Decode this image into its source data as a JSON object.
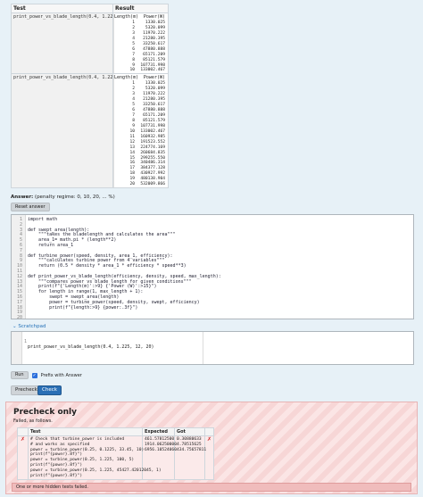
{
  "example_table": {
    "col_test": "Test",
    "col_result": "Result",
    "result_header_length": "Length(m)",
    "result_header_power": "Power(W)",
    "row1": {
      "test": "print_power_vs_blade_length(0.4, 1.225, 12, 10)",
      "rows": [
        [
          "1",
          "1330.025"
        ],
        [
          "2",
          "5320.099"
        ],
        [
          "3",
          "11970.222"
        ],
        [
          "4",
          "21280.395"
        ],
        [
          "5",
          "33250.617"
        ],
        [
          "6",
          "47880.888"
        ],
        [
          "7",
          "65171.209"
        ],
        [
          "8",
          "85121.579"
        ],
        [
          "9",
          "107731.998"
        ],
        [
          "10",
          "133002.467"
        ]
      ]
    },
    "row2": {
      "test": "print_power_vs_blade_length(0.4, 1.225, 12, 20)",
      "rows": [
        [
          "1",
          "1330.025"
        ],
        [
          "2",
          "5320.099"
        ],
        [
          "3",
          "11970.222"
        ],
        [
          "4",
          "21280.395"
        ],
        [
          "5",
          "33250.617"
        ],
        [
          "6",
          "47880.888"
        ],
        [
          "7",
          "65171.209"
        ],
        [
          "8",
          "85121.579"
        ],
        [
          "9",
          "107731.998"
        ],
        [
          "10",
          "133002.467"
        ],
        [
          "11",
          "160932.985"
        ],
        [
          "12",
          "191523.552"
        ],
        [
          "13",
          "224774.169"
        ],
        [
          "14",
          "260684.835"
        ],
        [
          "15",
          "299255.550"
        ],
        [
          "16",
          "340486.314"
        ],
        [
          "17",
          "384377.128"
        ],
        [
          "18",
          "430927.992"
        ],
        [
          "19",
          "480138.904"
        ],
        [
          "20",
          "532009.866"
        ]
      ]
    }
  },
  "answer": {
    "label": "Answer:",
    "penalty": "(penalty regime: 0, 10, 20, ... %)",
    "reset_label": "Reset answer"
  },
  "code_lines": [
    "import math",
    "",
    "def swept_area(length):",
    "    \"\"\"takes the bladelength and calculates the area\"\"\"",
    "    area_1= math.pi * (length**2)",
    "    return area_1",
    "",
    "def turbine_power(speed, density, area_1, efficiency):",
    "    \"\"\"calculates turbine power from 4 variables\"\"\"",
    "    return (0.5 * density * area_1 * efficiency * speed**3)",
    "",
    "def print_power_vs_blade_length(efficiency, density, speed, max_length):",
    "    \"\"\"compares power vs blade length for given conditions\"\"\"",
    "    print(f\"{'Length(m)':>9} {'Power (W)':>15}\")",
    "    for length in range(1, max_length + 1):",
    "        swept = swept_area(length)",
    "        power = turbine_power(speed, density, swept, efficiency)",
    "        print(f\"{length:>9} {power:.3f}\")",
    "",
    ""
  ],
  "scratchpad": {
    "toggle_label": "Scratchpad",
    "line_number": "1",
    "code": "print_power_vs_blade_length(0.4, 1.225, 12, 20)",
    "run_label": "Run",
    "prefix_label": "Prefix with Answer",
    "prefix_checked": true
  },
  "buttons": {
    "precheck": "Precheck",
    "check": "Check"
  },
  "results": {
    "title": "Precheck only",
    "subtitle": "Failed, as follows.",
    "col_test": "Test",
    "col_expected": "Expected",
    "col_got": "Got",
    "test_code": "# Check that turbine_power is included\n# and works as specified\npower = turbine_power(0.25, 0.1225, 33.45, 10)\nprint(f\"{power}.8f}\")\npower = turbine_power(0.25, 1.225, 100, 5)\nprint(f\"{power}.8f}\")\npower = turbine_power(0.25, 1.225, 45427.42012045, 1)\nprint(f\"{power}.8f}\")",
    "expected": "461.57812500\n1914.06250000\n6956.10524060",
    "got": "0.30880633\n4.78515625\n434.75657811",
    "fail_message": "One or more hidden tests failed."
  },
  "colors": {
    "accent": "#2a6fb5",
    "fail_red": "#cf2c2c"
  }
}
